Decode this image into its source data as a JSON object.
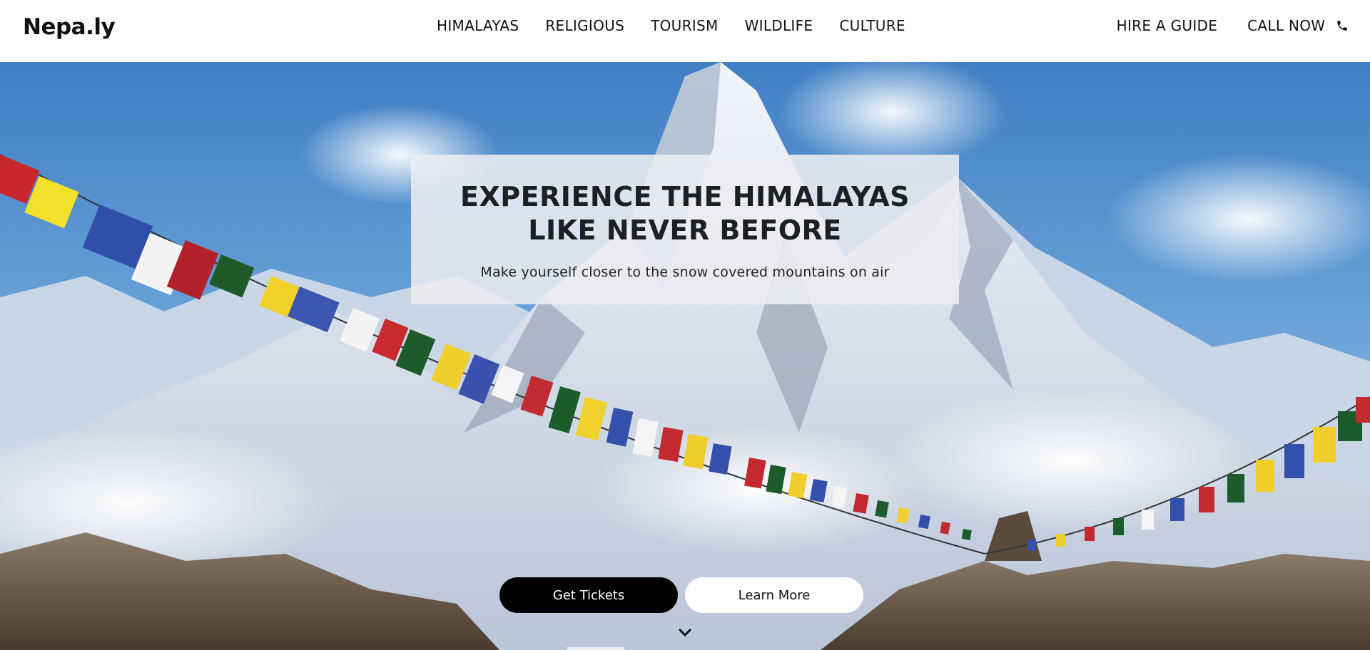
{
  "brand": {
    "name": "Nepa.ly"
  },
  "nav": {
    "links": [
      "HIMALAYAS",
      "RELIGIOUS",
      "TOURISM",
      "WILDLIFE",
      "CULTURE"
    ],
    "hire_guide": "HIRE A GUIDE",
    "call_now": "CALL NOW"
  },
  "hero": {
    "title": "EXPERIENCE THE HIMALAYAS LIKE NEVER BEFORE",
    "subtitle": "Make yourself closer to the snow covered mountains on air",
    "primary_button": "Get Tickets",
    "secondary_button": "Learn More",
    "background": "snow-covered-mountain-with-prayer-flags",
    "scroll_icon": "chevron-down-icon"
  },
  "colors": {
    "nav_bg": "#ffffff",
    "text": "#111111",
    "primary_button_bg": "#000000",
    "secondary_button_bg": "#ffffff",
    "sky": "#4f8fd0"
  }
}
